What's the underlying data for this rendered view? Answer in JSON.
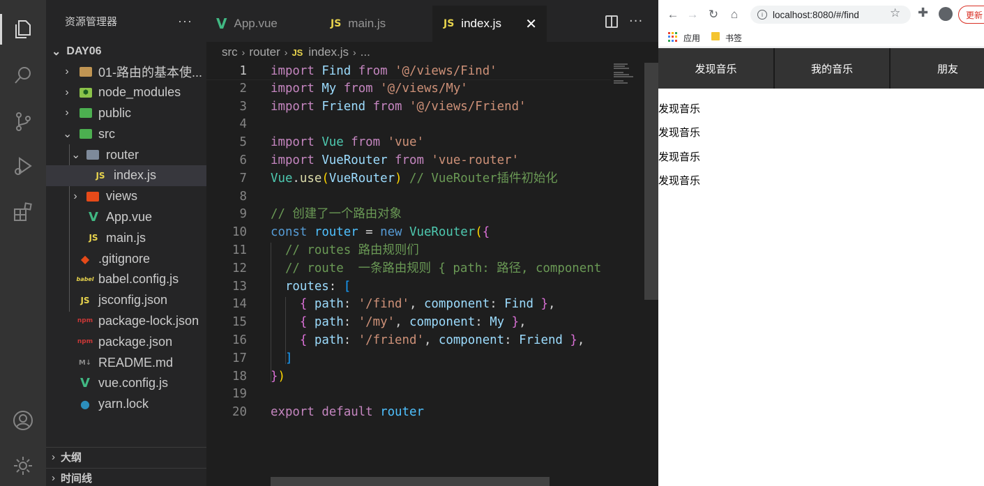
{
  "explorer": {
    "title": "资源管理器",
    "more": "···",
    "root": "DAY06",
    "items": [
      {
        "label": "01-路由的基本使...",
        "icon": "folder-icon"
      },
      {
        "label": "node_modules",
        "icon": "node-folder-icon"
      },
      {
        "label": "public",
        "icon": "public-folder-icon"
      },
      {
        "label": "src",
        "icon": "src-folder-icon"
      },
      {
        "label": "router",
        "icon": "router-folder-icon"
      },
      {
        "label": "index.js",
        "icon": "js-file-icon",
        "icon_text": "JS"
      },
      {
        "label": "views",
        "icon": "views-folder-icon"
      },
      {
        "label": "App.vue",
        "icon": "vue-file-icon",
        "icon_text": "V"
      },
      {
        "label": "main.js",
        "icon": "js-file-icon",
        "icon_text": "JS"
      },
      {
        "label": ".gitignore",
        "icon": "git-icon"
      },
      {
        "label": "babel.config.js",
        "icon": "babel-icon",
        "icon_text": "babel"
      },
      {
        "label": "jsconfig.json",
        "icon": "js-file-icon",
        "icon_text": "JS"
      },
      {
        "label": "package-lock.json",
        "icon": "npm-icon",
        "icon_text": "npm"
      },
      {
        "label": "package.json",
        "icon": "npm-icon",
        "icon_text": "npm"
      },
      {
        "label": "README.md",
        "icon": "markdown-icon",
        "icon_text": "M↓"
      },
      {
        "label": "vue.config.js",
        "icon": "vue-config-icon",
        "icon_text": "V"
      },
      {
        "label": "yarn.lock",
        "icon": "yarn-icon"
      }
    ],
    "outline": "大纲",
    "timeline": "时间线"
  },
  "tabs": [
    {
      "label": "App.vue",
      "icon": "V"
    },
    {
      "label": "main.js",
      "icon": "JS"
    },
    {
      "label": "index.js",
      "icon": "JS"
    }
  ],
  "tab_close": "✕",
  "editor_more": "···",
  "breadcrumb": {
    "parts": [
      "src",
      "router",
      "index.js",
      "..."
    ],
    "file_icon": "JS"
  },
  "code": {
    "line_numbers": [
      "1",
      "2",
      "3",
      "4",
      "5",
      "6",
      "7",
      "8",
      "9",
      "10",
      "11",
      "12",
      "13",
      "14",
      "15",
      "16",
      "17",
      "18",
      "19",
      "20"
    ],
    "lines": [
      "import Find from '@/views/Find'",
      "import My from '@/views/My'",
      "import Friend from '@/views/Friend'",
      "",
      "import Vue from 'vue'",
      "import VueRouter from 'vue-router'",
      "Vue.use(VueRouter) // VueRouter插件初始化",
      "",
      "// 创建了一个路由对象",
      "const router = new VueRouter({",
      "  // routes 路由规则们",
      "  // route  一条路由规则 { path: 路径, component",
      "  routes: [",
      "    { path: '/find', component: Find },",
      "    { path: '/my', component: My },",
      "    { path: '/friend', component: Friend },",
      "  ]",
      "})",
      "",
      "export default router"
    ]
  },
  "browser": {
    "url": "localhost:8080/#/find",
    "update_label": "更新",
    "bookmarks": {
      "apps": "应用",
      "folder": "书签"
    },
    "nav_links": [
      "发现音乐",
      "我的音乐",
      "朋友"
    ],
    "content_lines": [
      "发现音乐",
      "发现音乐",
      "发现音乐",
      "发现音乐"
    ]
  }
}
